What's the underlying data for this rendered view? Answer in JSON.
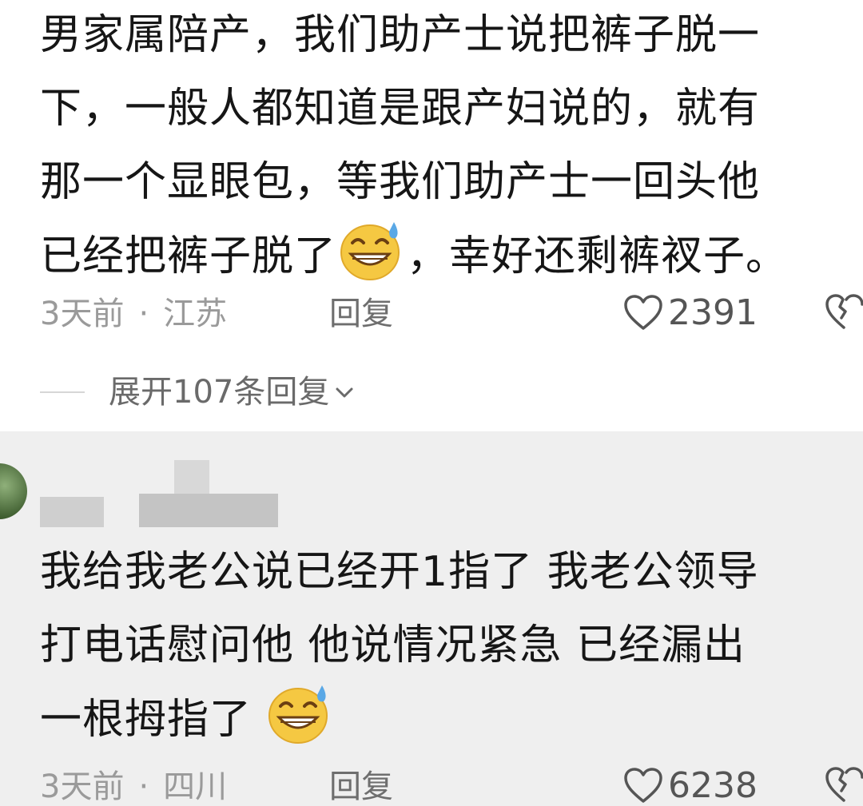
{
  "comments": [
    {
      "lines": [
        "男家属陪产，我们助产士说把裤子脱一",
        "下，一般人都知道是跟产妇说的，就有",
        "那一个显眼包，等我们助产士一回头他"
      ],
      "last_line_before_emoji": "已经把裤子脱了",
      "last_line_after_emoji": "，幸好还剩裤衩子。",
      "time": "3天前",
      "separator": "·",
      "location": "江苏",
      "reply_label": "回复",
      "likes": "2391",
      "expand_label": "展开107条回复"
    },
    {
      "lines": [
        "我给我老公说已经开1指了 我老公领导",
        "打电话慰问他 他说情况紧急 已经漏出"
      ],
      "last_line_before_emoji": "一根拇指了",
      "time": "3天前",
      "separator": "·",
      "location": "四川",
      "reply_label": "回复",
      "likes": "6238"
    }
  ],
  "icons": {
    "emoji": "sweat-smile-emoji-icon",
    "like": "heart-outline-icon",
    "dislike": "broken-heart-icon",
    "expand": "chevron-down-icon"
  },
  "colors": {
    "top_background": "#ffffff",
    "bottom_background": "#efefef",
    "meta_text": "#9a9a9a"
  }
}
